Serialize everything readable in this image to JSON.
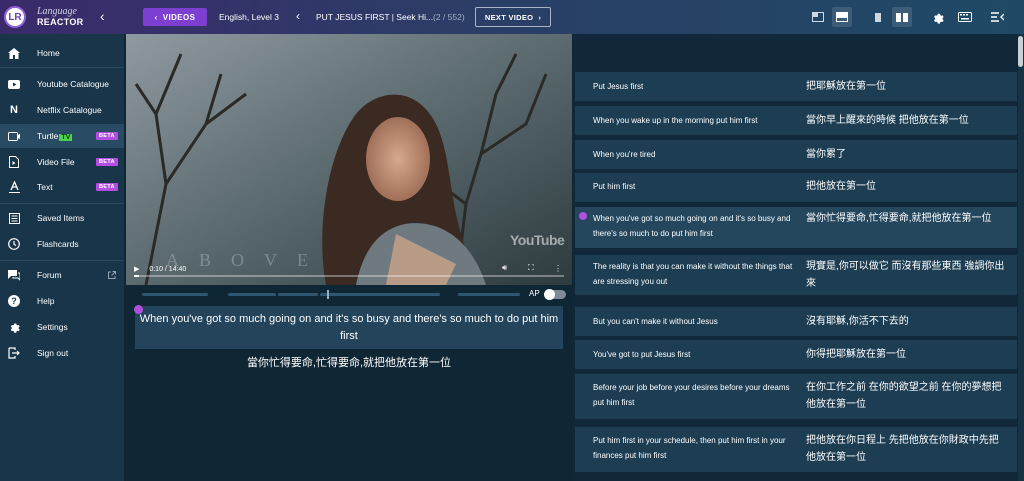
{
  "brand": {
    "logo_text": "LR",
    "line1": "Language",
    "line2": "REACTOR"
  },
  "topbar": {
    "videos_label": "VIDEOS",
    "lang_level": "English, Level 3",
    "video_title": "PUT JESUS FIRST | Seek Hi...",
    "video_count": "(2 / 552)",
    "next_label": "NEXT VIDEO"
  },
  "sidebar": {
    "home": "Home",
    "youtube": "Youtube Catalogue",
    "netflix": "Netflix Catalogue",
    "turtle": "Turtle",
    "turtle_tv": "TV",
    "video_file": "Video File",
    "text": "Text",
    "beta": "BETA",
    "saved": "Saved Items",
    "flashcards": "Flashcards",
    "forum": "Forum",
    "help": "Help",
    "settings": "Settings",
    "signout": "Sign out"
  },
  "player": {
    "time": "0:10 / 14:40",
    "progress": 0.011,
    "youtube_logo": "YouTube",
    "watermark": "ABOVE"
  },
  "ap_label": "AP",
  "current_subtitle": {
    "text": "When you've got so much going on and it's so busy and there's so much to do put him first",
    "translation": "當你忙得要命,忙得要命,就把他放在第一位"
  },
  "subtitles": [
    {
      "en": "Put Jesus first",
      "zh": "把耶穌放在第一位"
    },
    {
      "en": "When you wake up in the morning put him first",
      "zh": "當你早上醒來的時候 把他放在第一位"
    },
    {
      "en": "When you're tired",
      "zh": "當你累了"
    },
    {
      "en": "Put him first",
      "zh": "把他放在第一位"
    },
    {
      "en": "When you've got so much going on and it's so busy and there's so much to do put him first",
      "zh": "當你忙得要命,忙得要命,就把他放在第一位"
    },
    {
      "en": "The reality is that you can make it without the things that are stressing you out",
      "zh": "現實是,你可以做它 而沒有那些東西 強調你出來"
    },
    {
      "en": "But you can't make it without Jesus",
      "zh": "沒有耶穌,你活不下去的"
    },
    {
      "en": "You've got to put Jesus first",
      "zh": "你得把耶穌放在第一位"
    },
    {
      "en": "Before your job before your desires before your dreams put him first",
      "zh": "在你工作之前 在你的欲望之前 在你的夢想把他放在第一位"
    },
    {
      "en": "Put him first in your schedule, then put him first in your finances put him first",
      "zh": "把他放在你日程上 先把他放在你財政中先把他放在第一位"
    }
  ]
}
